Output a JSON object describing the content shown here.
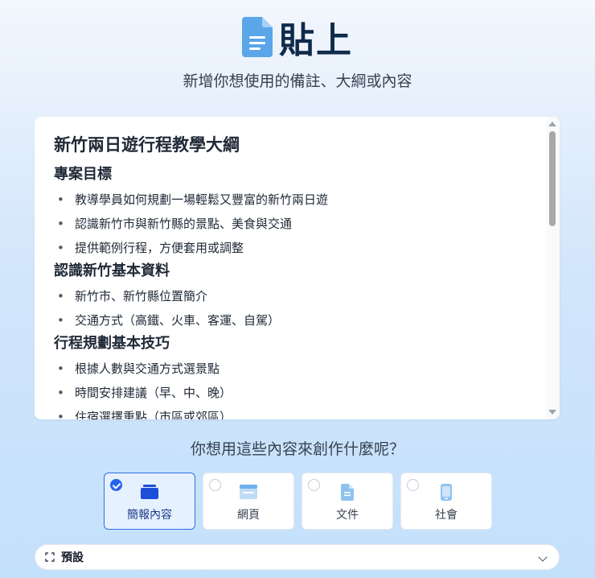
{
  "header": {
    "title": "貼上",
    "subtitle": "新增你想使用的備註、大綱或內容",
    "icon": "document-icon",
    "icon_color": "#5aa6e8"
  },
  "editor": {
    "doc_title": "新竹兩日遊行程教學大綱",
    "sections": [
      {
        "heading": "專案目標",
        "items": [
          "教導學員如何規劃一場輕鬆又豐富的新竹兩日遊",
          "認識新竹市與新竹縣的景點、美食與交通",
          "提供範例行程，方便套用或調整"
        ]
      },
      {
        "heading": "認識新竹基本資料",
        "items": [
          "新竹市、新竹縣位置簡介",
          "交通方式（高鐵、火車、客運、自駕）"
        ]
      },
      {
        "heading": "行程規劃基本技巧",
        "items": [
          "根據人數與交通方式選景點",
          "時間安排建議（早、中、晚）",
          "住宿選擇重點（市區或郊區）"
        ]
      }
    ]
  },
  "question": "你想用這些內容來創作什麼呢？",
  "options": [
    {
      "label": "簡報內容",
      "icon": "presentation-icon",
      "selected": true
    },
    {
      "label": "網頁",
      "icon": "webpage-icon",
      "selected": false
    },
    {
      "label": "文件",
      "icon": "document-icon",
      "selected": false
    },
    {
      "label": "社會",
      "icon": "mobile-icon",
      "selected": false
    }
  ],
  "preset": {
    "label": "預設",
    "icon": "expand-icon"
  },
  "colors": {
    "accent": "#2563eb",
    "icon_blue": "#5aa6e8",
    "selected_bg": "#e6f1ff"
  }
}
